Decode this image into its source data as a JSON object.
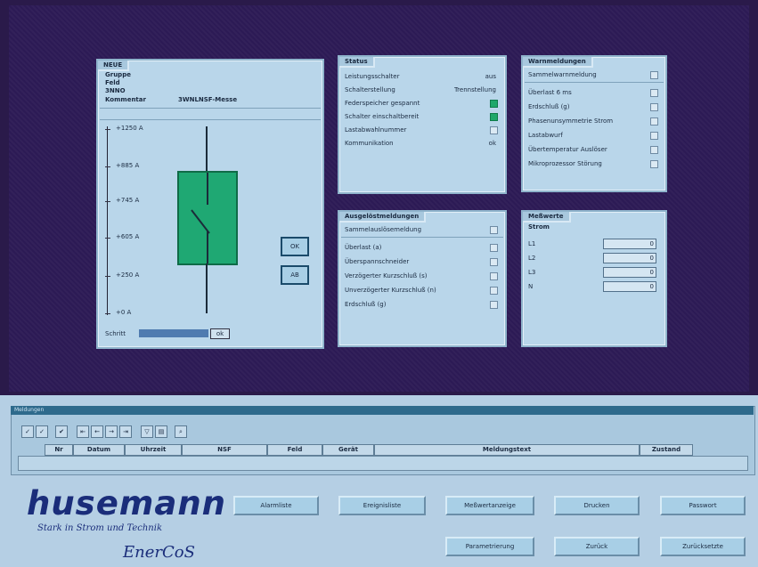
{
  "left_panel": {
    "title": "NEUE",
    "info_labels": [
      "Gruppe",
      "Feld",
      "3NNO"
    ],
    "comment_label": "Kommentar",
    "comment_value": "3WNLNSF-Messe",
    "scale_ticks": [
      "+1250 A",
      "+885 A",
      "+745 A",
      "+605 A",
      "+250 A",
      "+0 A"
    ],
    "ok_button": "OK",
    "ab_button": "AB",
    "footer_label": "Schritt",
    "footer_button": "ok"
  },
  "status": {
    "title": "Status",
    "rows": [
      {
        "label": "Leistungsschalter",
        "value": "aus",
        "check": "none"
      },
      {
        "label": "Schalterstellung",
        "value": "Trennstellung",
        "check": "none"
      },
      {
        "label": "Federspeicher gespannt",
        "value": "",
        "check": "on"
      },
      {
        "label": "Schalter einschaltbereit",
        "value": "",
        "check": "on"
      },
      {
        "label": "Lastabwahlnummer",
        "value": "",
        "check": "off"
      },
      {
        "label": "Kommunikation",
        "value": "ok",
        "check": "none"
      }
    ]
  },
  "warnings": {
    "title": "Warnmeldungen",
    "header": "Sammelwarnmeldung",
    "rows": [
      "Überlast 6 ms",
      "Erdschluß (g)",
      "Phasenunsymmetrie Strom",
      "Lastabwurf",
      "Übertemperatur Auslöser",
      "Mikroprozessor Störung"
    ]
  },
  "trips": {
    "title": "Ausgelöstmeldungen",
    "header": "Sammelauslösemeldung",
    "rows": [
      "Überlast (a)",
      "Überspannschneider",
      "Verzögerter Kurzschluß (s)",
      "Unverzögerter Kurzschluß (n)",
      "Erdschluß (g)"
    ]
  },
  "measurements": {
    "title": "Meßwerte",
    "section": "Strom",
    "rows": [
      {
        "label": "L1",
        "value": "0"
      },
      {
        "label": "L2",
        "value": "0"
      },
      {
        "label": "L3",
        "value": "0"
      },
      {
        "label": "N",
        "value": "0"
      }
    ]
  },
  "bottom": {
    "window_label": "Meldungen",
    "columns": [
      "Nr",
      "Datum",
      "Uhrzeit",
      "NSF",
      "Feld",
      "Gerät",
      "Meldungstext",
      "Zustand"
    ]
  },
  "brand": {
    "name": "husemann",
    "tagline": "Stark in Strom und Technik",
    "product": "EnerCoS"
  },
  "nav_buttons": {
    "row1": [
      "Alarmliste",
      "Ereignisliste",
      "Meßwertanzeige",
      "Drucken",
      "Passwort"
    ],
    "row2": [
      "Parametrierung",
      "Zurück",
      "Zurücksetzte"
    ]
  },
  "colors": {
    "background": "#2c1a55",
    "panel": "#b9d6ea",
    "breaker_green": "#1fa873",
    "brand_blue": "#1a2d7a"
  }
}
